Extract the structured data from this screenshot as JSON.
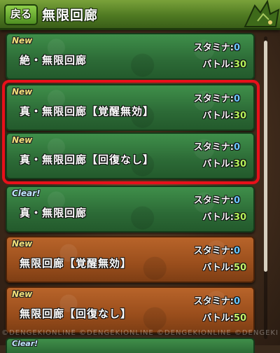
{
  "header": {
    "back_label": "戻る",
    "title": "無限回廊"
  },
  "rows": [
    {
      "tag": "New",
      "name": "絶・無限回廊",
      "stamina_label": "スタミナ:",
      "stamina": "0",
      "battle_label": "バトル:",
      "battle": "30"
    },
    {
      "tag": "New",
      "name": "真・無限回廊【覚醒無効】",
      "stamina_label": "スタミナ:",
      "stamina": "0",
      "battle_label": "バトル:",
      "battle": "30"
    },
    {
      "tag": "New",
      "name": "真・無限回廊【回復なし】",
      "stamina_label": "スタミナ:",
      "stamina": "0",
      "battle_label": "バトル:",
      "battle": "30"
    },
    {
      "tag": "Clear!",
      "name": "真・無限回廊",
      "stamina_label": "スタミナ:",
      "stamina": "0",
      "battle_label": "バトル:",
      "battle": "30"
    },
    {
      "tag": "New",
      "name": "無限回廊【覚醒無効】",
      "stamina_label": "スタミナ:",
      "stamina": "0",
      "battle_label": "バトル:",
      "battle": "50"
    },
    {
      "tag": "New",
      "name": "無限回廊【回復なし】",
      "stamina_label": "スタミナ:",
      "stamina": "0",
      "battle_label": "バトル:",
      "battle": "50"
    }
  ],
  "partial_row": {
    "tag": "Clear!"
  },
  "watermark": "©DENGEKIONLINE ©DENGEKIONLINE ©DENGEKIONLINE ©DENGEKI",
  "colors": {
    "highlight": "#e8101a",
    "green_row": "#2c6a36",
    "brown_row": "#9a4e1c"
  }
}
